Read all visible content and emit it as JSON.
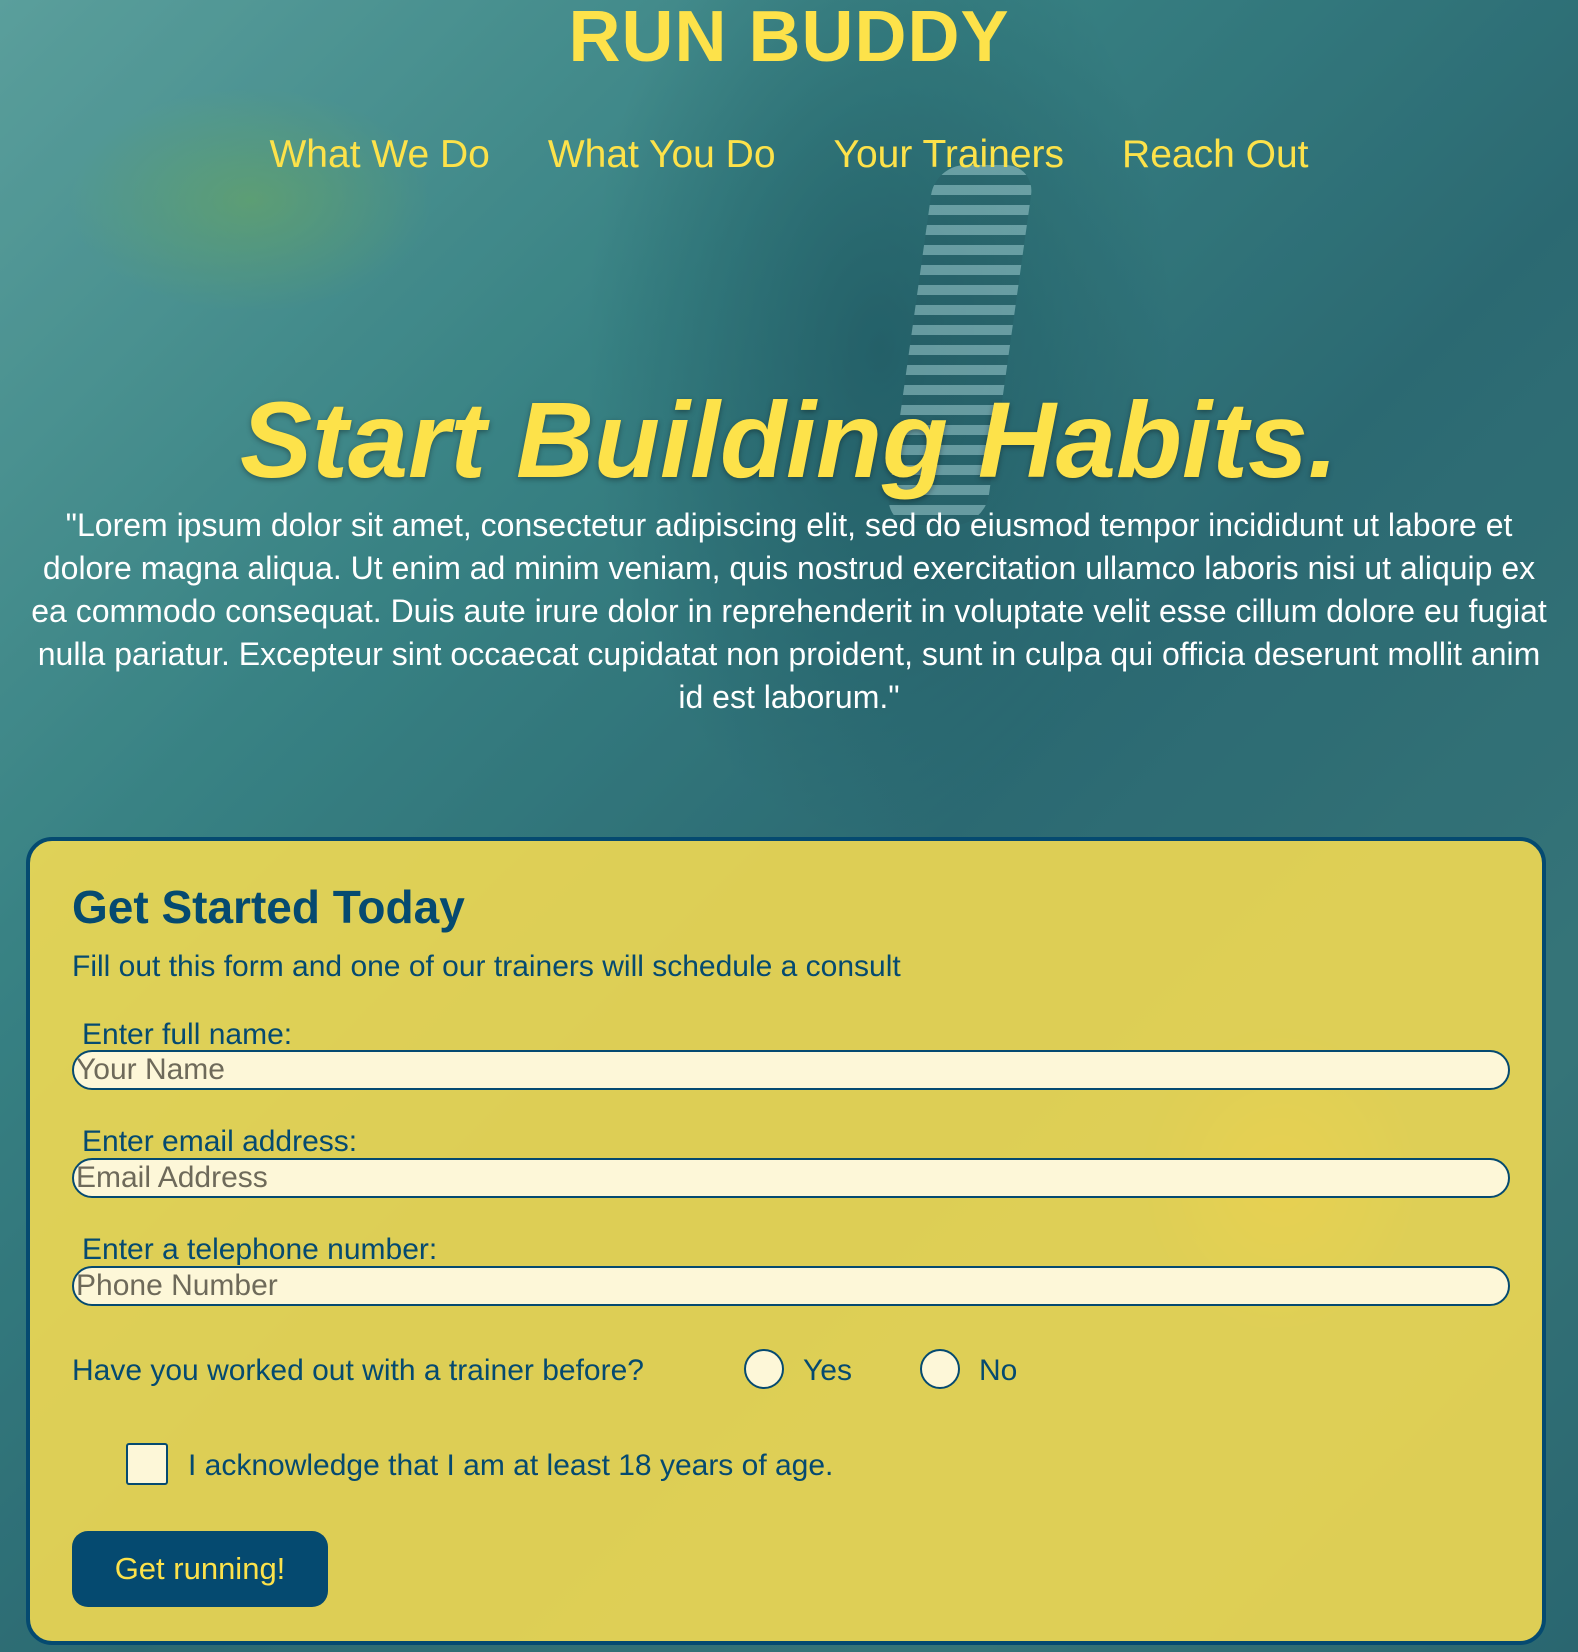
{
  "header": {
    "brand": "RUN BUDDY",
    "nav": [
      {
        "label": "What We Do"
      },
      {
        "label": "What You Do"
      },
      {
        "label": "Your Trainers"
      },
      {
        "label": "Reach Out"
      }
    ]
  },
  "hero": {
    "title": "Start Building Habits.",
    "text": "\"Lorem ipsum dolor sit amet, consectetur adipiscing elit, sed do eiusmod tempor incididunt ut labore et dolore magna aliqua. Ut enim ad minim veniam, quis nostrud exercitation ullamco laboris nisi ut aliquip ex ea commodo consequat. Duis aute irure dolor in reprehenderit in voluptate velit esse cillum dolore eu fugiat nulla pariatur. Excepteur sint occaecat cupidatat non proident, sunt in culpa qui officia deserunt mollit anim id est laborum.\""
  },
  "form": {
    "title": "Get Started Today",
    "subtitle": "Fill out this form and one of our trainers will schedule a consult",
    "fields": [
      {
        "label": "Enter full name:",
        "placeholder": "Your Name",
        "value": ""
      },
      {
        "label": "Enter email address:",
        "placeholder": "Email Address",
        "value": ""
      },
      {
        "label": "Enter a telephone number:",
        "placeholder": "Phone Number",
        "value": ""
      }
    ],
    "question": "Have you worked out with a trainer before?",
    "options": [
      {
        "label": "Yes",
        "selected": false
      },
      {
        "label": "No",
        "selected": false
      }
    ],
    "acknowledge": {
      "label": "I acknowledge that I am at least 18 years of age.",
      "checked": false
    },
    "submit_label": "Get running!"
  },
  "colors": {
    "accent_yellow": "#fde24a",
    "brand_navy": "#054a70",
    "form_background": "#fade50"
  }
}
